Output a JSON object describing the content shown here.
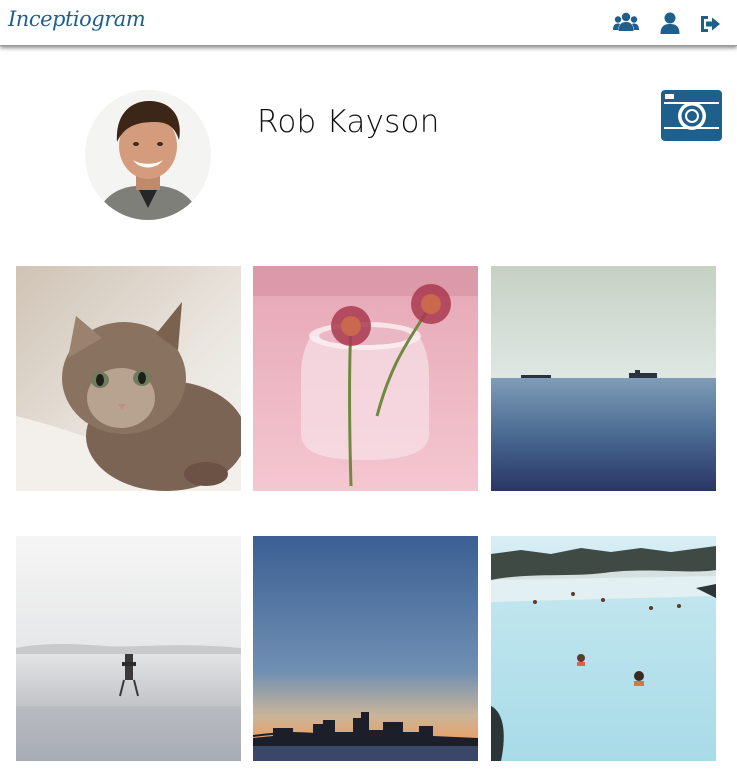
{
  "app": {
    "brand": "Inceptiogram",
    "accent_color": "#1f5f8b"
  },
  "nav": {
    "items": [
      {
        "icon": "users-icon"
      },
      {
        "icon": "user-icon"
      },
      {
        "icon": "sign-out-icon"
      }
    ]
  },
  "profile": {
    "name": "Rob Kayson",
    "avatar_icon": "profile-photo",
    "upload_icon": "camera-icon"
  },
  "gallery": {
    "photos": [
      {
        "subject": "kitten"
      },
      {
        "subject": "flowers-in-jar"
      },
      {
        "subject": "sea-with-ships"
      },
      {
        "subject": "misty-sea-marker"
      },
      {
        "subject": "city-skyline-dusk"
      },
      {
        "subject": "blue-lagoon-bathers"
      }
    ]
  }
}
